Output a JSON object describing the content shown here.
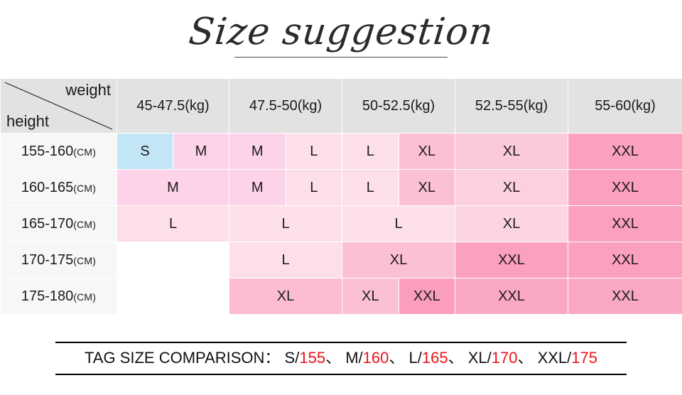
{
  "title": {
    "text": "Size suggestion"
  },
  "table": {
    "corner": {
      "weight_label": "weight",
      "height_label": "height"
    },
    "column_headers": [
      "45-47.5(kg)",
      "47.5-50(kg)",
      "50-52.5(kg)",
      "52.5-55(kg)",
      "55-60(kg)"
    ],
    "row_headers": [
      {
        "range": "155-160",
        "unit": "(CM)"
      },
      {
        "range": "160-165",
        "unit": "(CM)"
      },
      {
        "range": "165-170",
        "unit": "(CM)"
      },
      {
        "range": "170-175",
        "unit": "(CM)"
      },
      {
        "range": "175-180",
        "unit": "(CM)"
      }
    ],
    "rows": [
      {
        "height": "155-160(CM)",
        "cells": [
          {
            "split": true,
            "values": [
              "S",
              "M"
            ],
            "colors": [
              "#c3e6f7",
              "#fcd3e8"
            ]
          },
          {
            "split": true,
            "values": [
              "M",
              "L"
            ],
            "colors": [
              "#fcd3e8",
              "#fde0e7"
            ]
          },
          {
            "split": true,
            "values": [
              "L",
              "XL"
            ],
            "colors": [
              "#fde0e7",
              "#fcc0d3"
            ]
          },
          {
            "split": false,
            "values": [
              "XL"
            ],
            "colors": [
              "#fcc9d9"
            ]
          },
          {
            "split": false,
            "values": [
              "XXL"
            ],
            "colors": [
              "#fba0bd"
            ]
          }
        ]
      },
      {
        "height": "160-165(CM)",
        "cells": [
          {
            "split": false,
            "values": [
              "M"
            ],
            "colors": [
              "#fcd3e8"
            ]
          },
          {
            "split": true,
            "values": [
              "M",
              "L"
            ],
            "colors": [
              "#fcd3e8",
              "#fde0e7"
            ]
          },
          {
            "split": true,
            "values": [
              "L",
              "XL"
            ],
            "colors": [
              "#fde0e7",
              "#fcc0d3"
            ]
          },
          {
            "split": false,
            "values": [
              "XL"
            ],
            "colors": [
              "#fcd0de"
            ]
          },
          {
            "split": false,
            "values": [
              "XXL"
            ],
            "colors": [
              "#fba0bd"
            ]
          }
        ]
      },
      {
        "height": "165-170(CM)",
        "cells": [
          {
            "split": false,
            "values": [
              "L"
            ],
            "colors": [
              "#fde0e7"
            ]
          },
          {
            "split": false,
            "values": [
              "L"
            ],
            "colors": [
              "#fde0e7"
            ]
          },
          {
            "split": false,
            "values": [
              "L"
            ],
            "colors": [
              "#fde0e7"
            ]
          },
          {
            "split": false,
            "values": [
              "XL"
            ],
            "colors": [
              "#fcd5e1"
            ]
          },
          {
            "split": false,
            "values": [
              "XXL"
            ],
            "colors": [
              "#fba0bd"
            ]
          }
        ]
      },
      {
        "height": "170-175(CM)",
        "cells": [
          {
            "split": false,
            "values": [
              ""
            ],
            "colors": [
              "#ffffff"
            ]
          },
          {
            "split": false,
            "values": [
              "L"
            ],
            "colors": [
              "#fde0e7"
            ]
          },
          {
            "split": false,
            "values": [
              "XL"
            ],
            "colors": [
              "#fcc0d3"
            ]
          },
          {
            "split": false,
            "values": [
              "XXL"
            ],
            "colors": [
              "#fba0bd"
            ]
          },
          {
            "split": false,
            "values": [
              "XXL"
            ],
            "colors": [
              "#fba0bd"
            ]
          }
        ]
      },
      {
        "height": "175-180(CM)",
        "cells": [
          {
            "split": false,
            "values": [
              ""
            ],
            "colors": [
              "#ffffff"
            ]
          },
          {
            "split": false,
            "values": [
              "XL"
            ],
            "colors": [
              "#fcbdd2"
            ]
          },
          {
            "split": true,
            "values": [
              "XL",
              "XXL"
            ],
            "colors": [
              "#fcc0d3",
              "#fb9ebb"
            ]
          },
          {
            "split": false,
            "values": [
              "XXL"
            ],
            "colors": [
              "#fba9c3"
            ]
          },
          {
            "split": false,
            "values": [
              "XXL"
            ],
            "colors": [
              "#fba9c3"
            ]
          }
        ]
      }
    ]
  },
  "footer": {
    "label": "TAG SIZE COMPARISON：",
    "separator": "、",
    "entries": [
      {
        "size": "S/",
        "value": "155"
      },
      {
        "size": "M/",
        "value": "160"
      },
      {
        "size": "L/",
        "value": "165"
      },
      {
        "size": "XL/",
        "value": "170"
      },
      {
        "size": "XXL/",
        "value": "175"
      }
    ]
  },
  "colors": {
    "header_bg": "#e2e2e2",
    "row_head_bg": "#f7f7f7",
    "size_s": "#c3e6f7",
    "size_m": "#fcd3e8",
    "size_l": "#fde0e7",
    "size_xl": "#fcc0d3",
    "size_xxl": "#fba0bd",
    "accent_red": "#e8131a"
  }
}
